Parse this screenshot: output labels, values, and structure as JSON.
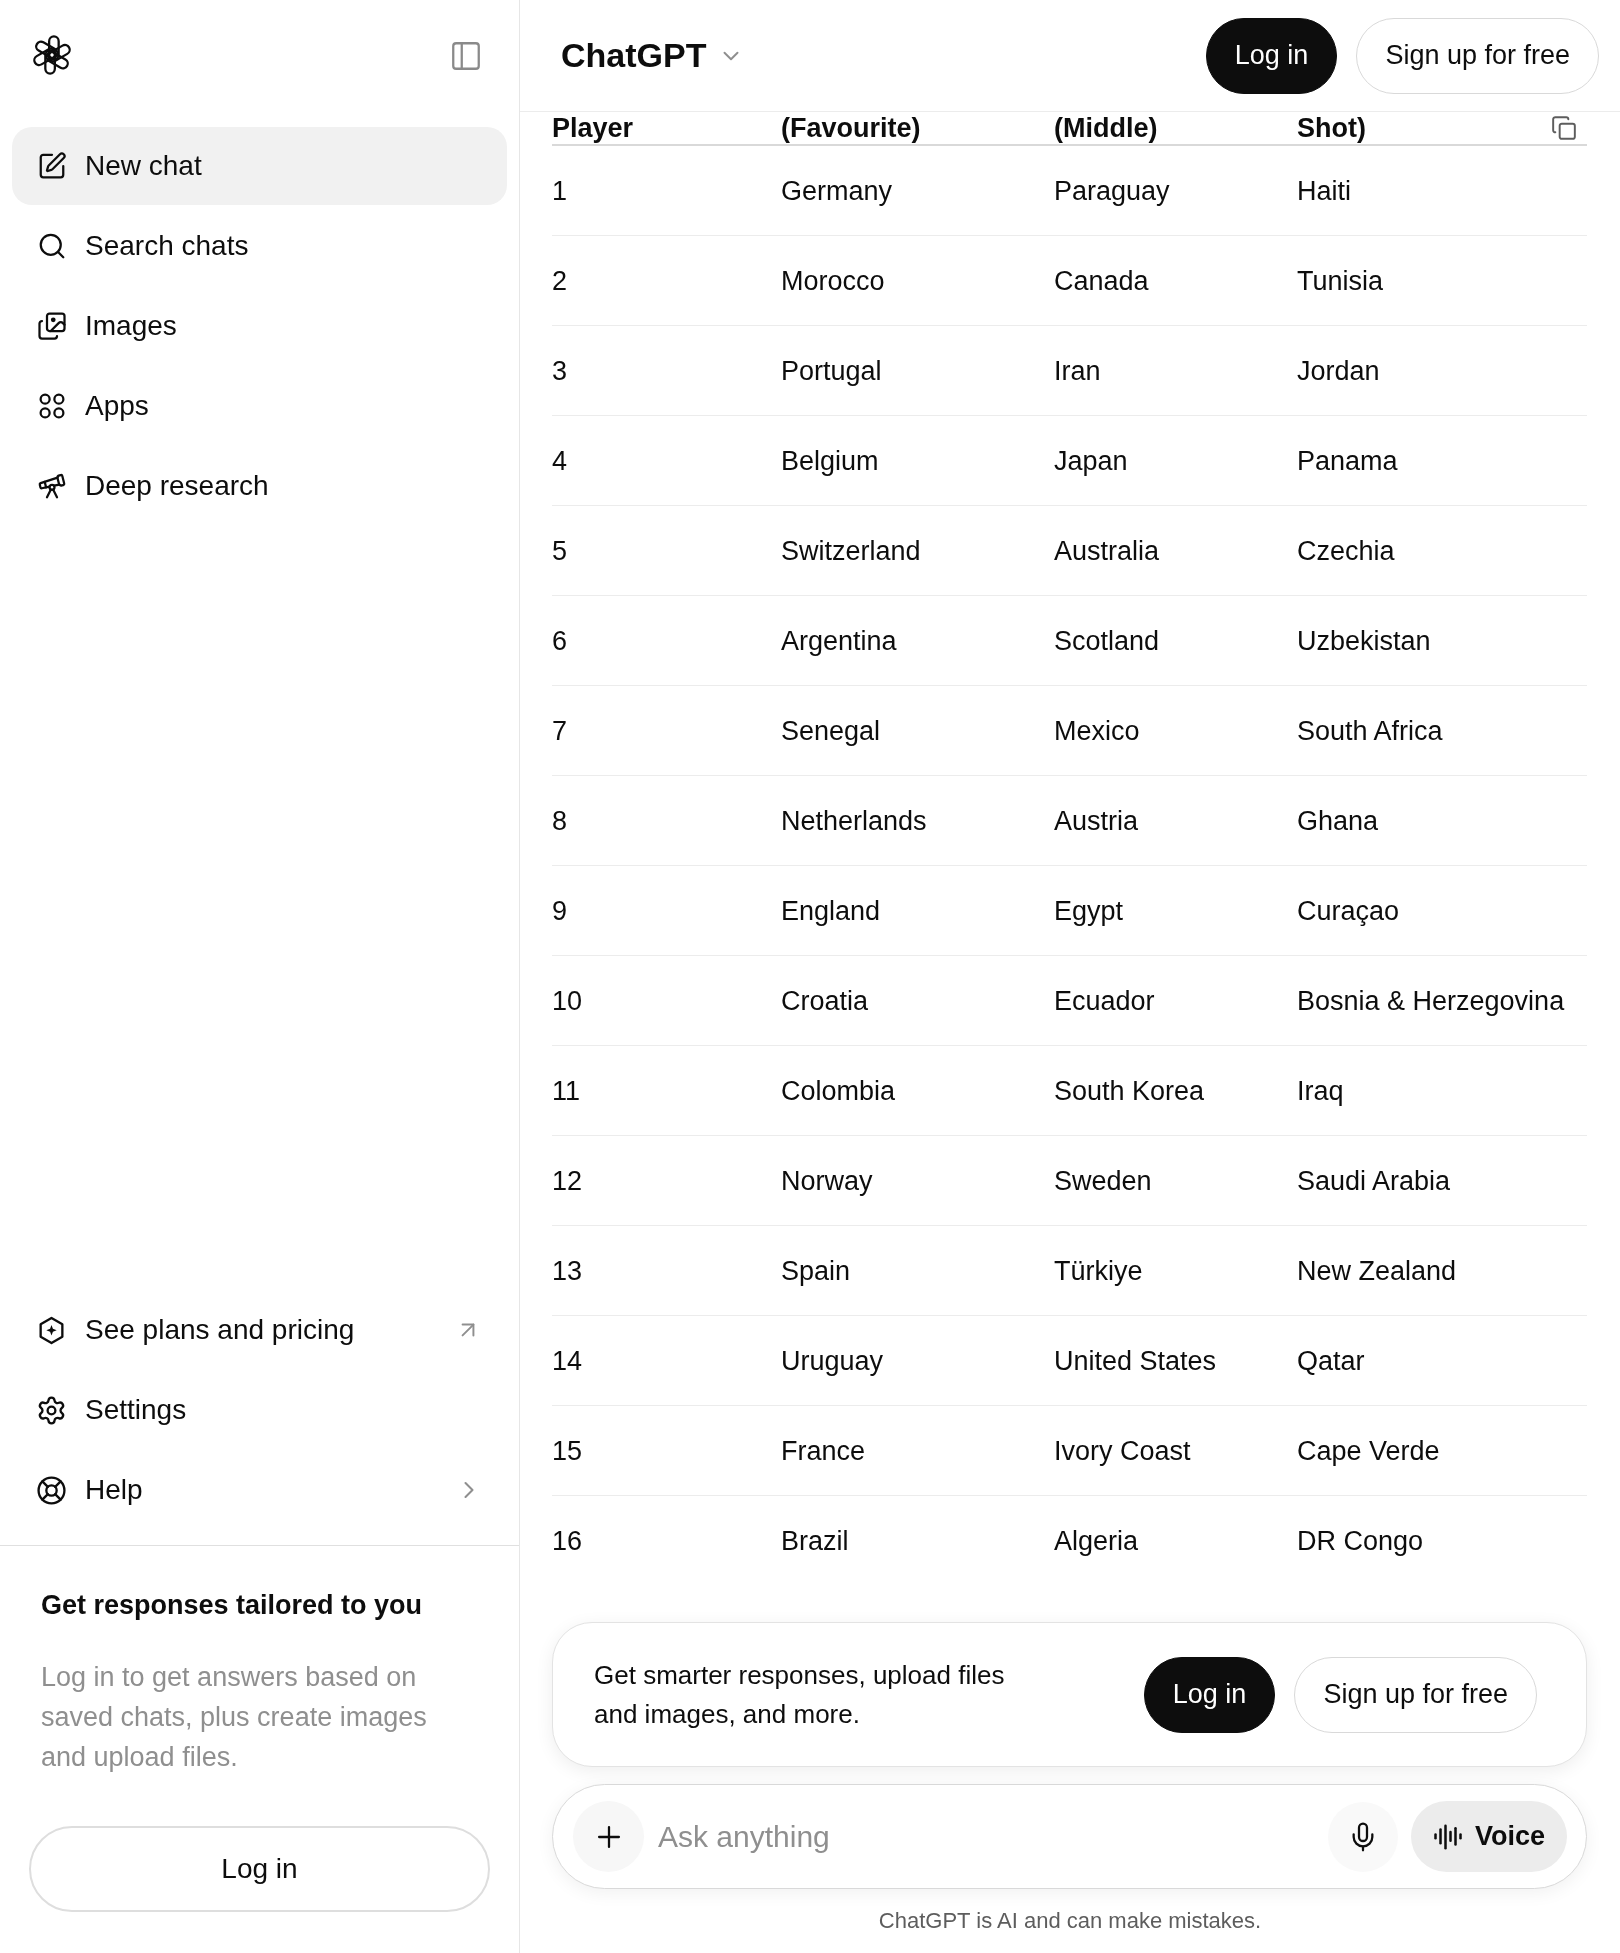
{
  "sidebar": {
    "items": [
      {
        "label": "New chat",
        "selected": true
      },
      {
        "label": "Search chats",
        "selected": false
      },
      {
        "label": "Images",
        "selected": false
      },
      {
        "label": "Apps",
        "selected": false
      },
      {
        "label": "Deep research",
        "selected": false
      }
    ],
    "footer_items": [
      {
        "label": "See plans and pricing",
        "kind": "external"
      },
      {
        "label": "Settings",
        "kind": "plain"
      },
      {
        "label": "Help",
        "kind": "submenu"
      }
    ],
    "promo": {
      "title": "Get responses tailored to you",
      "text": "Log in to get answers based on saved chats, plus create images and upload files.",
      "button": "Log in"
    }
  },
  "header": {
    "title": "ChatGPT",
    "buttons": [
      {
        "label": "Log in",
        "kind": "primary"
      },
      {
        "label": "Sign up for free",
        "kind": "secondary"
      }
    ]
  },
  "table": {
    "columns": [
      "Player",
      "(Favourite)",
      "(Middle)",
      "Shot)"
    ],
    "rows": [
      [
        "1",
        "Germany",
        "Paraguay",
        "Haiti"
      ],
      [
        "2",
        "Morocco",
        "Canada",
        "Tunisia"
      ],
      [
        "3",
        "Portugal",
        "Iran",
        "Jordan"
      ],
      [
        "4",
        "Belgium",
        "Japan",
        "Panama"
      ],
      [
        "5",
        "Switzerland",
        "Australia",
        "Czechia"
      ],
      [
        "6",
        "Argentina",
        "Scotland",
        "Uzbekistan"
      ],
      [
        "7",
        "Senegal",
        "Mexico",
        "South Africa"
      ],
      [
        "8",
        "Netherlands",
        "Austria",
        "Ghana"
      ],
      [
        "9",
        "England",
        "Egypt",
        "Curaçao"
      ],
      [
        "10",
        "Croatia",
        "Ecuador",
        "Bosnia & Herzegovina"
      ],
      [
        "11",
        "Colombia",
        "South Korea",
        "Iraq"
      ],
      [
        "12",
        "Norway",
        "Sweden",
        "Saudi Arabia"
      ],
      [
        "13",
        "Spain",
        "Türkiye",
        "New Zealand"
      ],
      [
        "14",
        "Uruguay",
        "United States",
        "Qatar"
      ],
      [
        "15",
        "France",
        "Ivory Coast",
        "Cape Verde"
      ],
      [
        "16",
        "Brazil",
        "Algeria",
        "DR Congo"
      ]
    ]
  },
  "banner": {
    "text": "Get smarter responses, upload files and images, and more.",
    "buttons": [
      {
        "label": "Log in",
        "kind": "primary"
      },
      {
        "label": "Sign up for free",
        "kind": "secondary"
      }
    ]
  },
  "composer": {
    "placeholder": "Ask anything",
    "voice_button": "Voice"
  },
  "disclaimer": "ChatGPT is AI and can make mistakes."
}
